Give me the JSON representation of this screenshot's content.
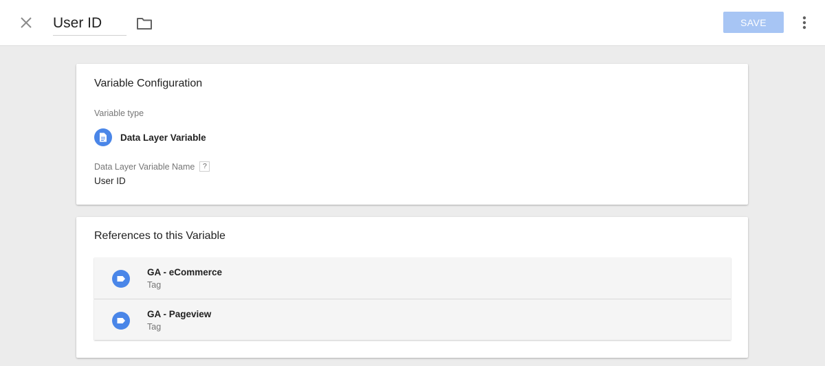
{
  "header": {
    "title": "User ID",
    "save_label": "SAVE",
    "icons": {
      "close": "close-icon",
      "folder": "folder-icon",
      "more": "more-vert-icon"
    }
  },
  "config_card": {
    "title": "Variable Configuration",
    "type_label": "Variable type",
    "type_value": "Data Layer Variable",
    "type_icon": "document-icon",
    "name_label": "Data Layer Variable Name",
    "help": "?",
    "name_value": "User ID"
  },
  "references_card": {
    "title": "References to this Variable",
    "items": [
      {
        "name": "GA - eCommerce",
        "kind": "Tag",
        "icon": "tag-icon"
      },
      {
        "name": "GA - Pageview",
        "kind": "Tag",
        "icon": "tag-icon"
      }
    ]
  },
  "colors": {
    "accent": "#4a86e8",
    "save_disabled": "#a7c5f4",
    "background": "#ececec"
  }
}
